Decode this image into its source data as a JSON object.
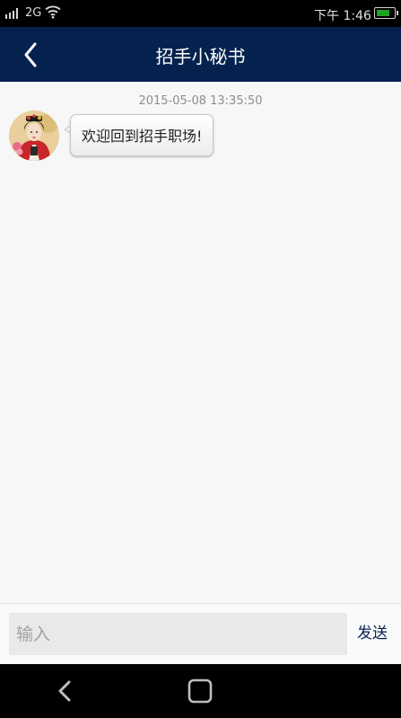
{
  "status_bar": {
    "network": "2G",
    "time": "下午 1:46",
    "battery_level": 0.8,
    "battery_color": "#1fa21f",
    "icons": [
      "signal-icon",
      "wifi-icon",
      "battery-icon"
    ]
  },
  "nav": {
    "title": "招手小秘书",
    "back_icon": "chevron-left-icon",
    "bar_color": "#05224f"
  },
  "chat": {
    "messages": [
      {
        "timestamp": "2015-05-08 13:35:50",
        "text": "欢迎回到招手职场!"
      }
    ]
  },
  "composer": {
    "placeholder": "输入",
    "value": "",
    "send_label": "发送"
  },
  "system_nav": {
    "icons": [
      "back-icon",
      "home-icon"
    ]
  }
}
